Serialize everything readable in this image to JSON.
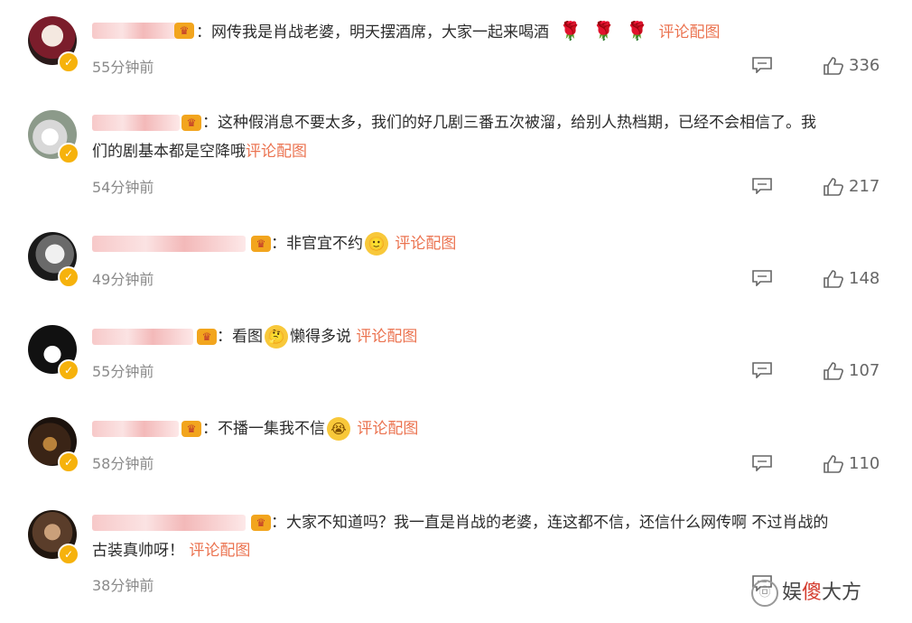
{
  "comments": [
    {
      "text": "网传我是肖战老婆，明天摆酒席，大家一起来喝酒",
      "emojis": [
        "🌹",
        "🌹",
        "🌹"
      ],
      "link": "评论配图",
      "time": "55分钟前",
      "likes": "336"
    },
    {
      "text": "这种假消息不要太多，我们的好几剧三番五次被溜，给别人热档期，已经不会相信了。我",
      "text2": "们的剧基本都是空降哦",
      "link": "评论配图",
      "time": "54分钟前",
      "likes": "217"
    },
    {
      "text": "非官宜不约",
      "emoji": "🙂",
      "link": "评论配图",
      "time": "49分钟前",
      "likes": "148"
    },
    {
      "text": "看图",
      "emoji": "🤔",
      "text_after": "懒得多说",
      "link": "评论配图",
      "time": "55分钟前",
      "likes": "107"
    },
    {
      "text": "不播一集我不信",
      "emoji": "😭",
      "link": "评论配图",
      "time": "58分钟前",
      "likes": "110"
    },
    {
      "text": "大家不知道吗？我一直是肖战的老婆，连这都不信，还信什么网传啊 不过肖战的",
      "text2": "古装真帅呀！",
      "link": "评论配图",
      "time": "38分钟前"
    }
  ],
  "colon": "：",
  "watermark": {
    "prefix": "娱",
    "red": "傻",
    "suffix": "大方",
    "logo": "㉤"
  },
  "icons": {
    "reply": "comment-icon",
    "like": "thumbs-up-icon",
    "badge": "verified-badge-icon",
    "crown": "fan-crown-icon"
  },
  "colors": {
    "link": "#eb7350",
    "badge": "#f6b20c"
  }
}
